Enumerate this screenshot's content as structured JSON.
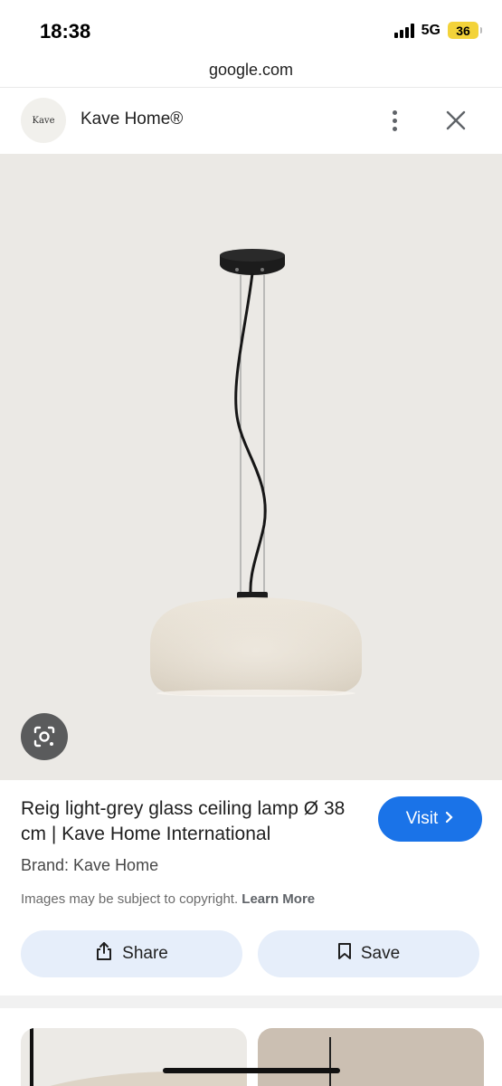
{
  "status_bar": {
    "time": "18:38",
    "network": "5G",
    "battery": "36"
  },
  "browser": {
    "url": "google.com"
  },
  "site": {
    "logo_text": "Kave",
    "name": "Kave Home®"
  },
  "product": {
    "title": "Reig light-grey glass ceiling lamp Ø 38 cm | Kave Home International",
    "brand_line": "Brand: Kave Home",
    "visit_label": "Visit",
    "copyright_text": "Images may be subject to copyright.",
    "learn_more_label": "Learn More"
  },
  "actions": {
    "share_label": "Share",
    "save_label": "Save"
  },
  "colors": {
    "accent": "#1a73e8",
    "pill_bg": "#e6eefa",
    "battery": "#f3d33a",
    "image_bg": "#ebe9e5"
  },
  "icons": [
    "signal-icon",
    "battery-icon",
    "more-vert-icon",
    "close-icon",
    "google-lens-icon",
    "chevron-right-icon",
    "share-icon",
    "bookmark-icon"
  ]
}
